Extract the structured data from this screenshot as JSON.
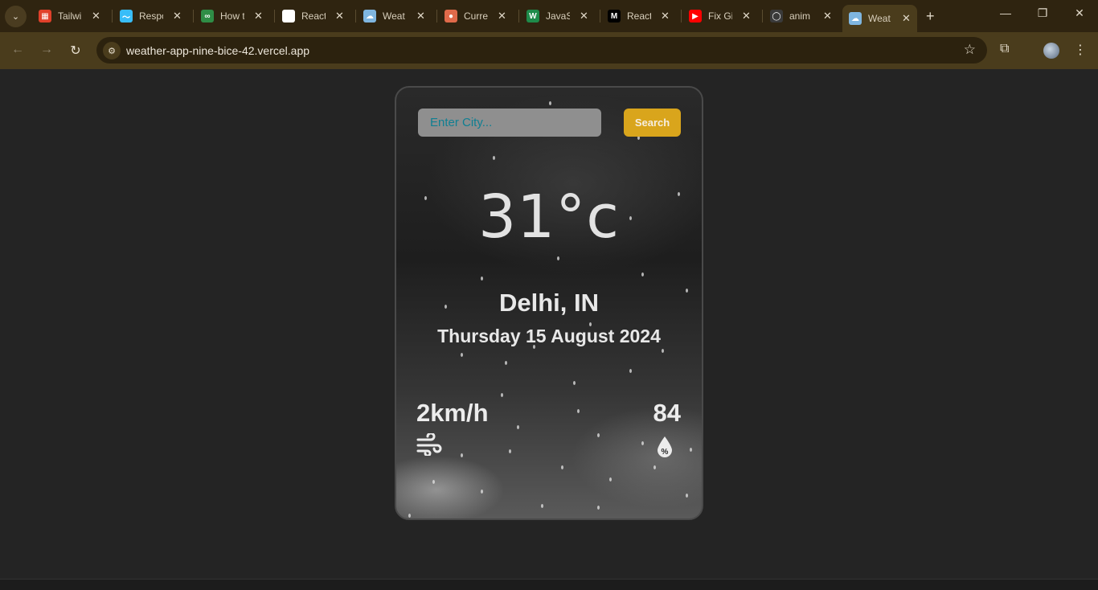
{
  "browser": {
    "tabs": [
      {
        "title": "Tailwi",
        "favicon_color": "#e0402a",
        "favicon_glyph": "▦"
      },
      {
        "title": "Respo",
        "favicon_color": "#38bdf8",
        "favicon_glyph": "〜"
      },
      {
        "title": "How t",
        "favicon_color": "#2f8d46",
        "favicon_glyph": "∞"
      },
      {
        "title": "React",
        "favicon_color": "#ffffff",
        "favicon_glyph": "◎"
      },
      {
        "title": "Weat",
        "favicon_color": "#7fb6e0",
        "favicon_glyph": "☁"
      },
      {
        "title": "Curre",
        "favicon_color": "#e06a4a",
        "favicon_glyph": "●"
      },
      {
        "title": "JavaS",
        "favicon_color": "#1e8a4a",
        "favicon_glyph": "W"
      },
      {
        "title": "React",
        "favicon_color": "#000000",
        "favicon_glyph": "M"
      },
      {
        "title": "Fix Gi",
        "favicon_color": "#ff0000",
        "favicon_glyph": "▶"
      },
      {
        "title": "anim",
        "favicon_color": "#3a3a3a",
        "favicon_glyph": "◯"
      }
    ],
    "active_tab": {
      "title": "Weat",
      "favicon_color": "#7fb6e0",
      "favicon_glyph": "☁"
    },
    "url": "weather-app-nine-bice-42.vercel.app"
  },
  "weather": {
    "search": {
      "placeholder": "Enter City...",
      "button_label": "Search"
    },
    "temperature": "31°c",
    "location": "Delhi, IN",
    "date": "Thursday 15 August 2024",
    "wind_speed": "2km/h",
    "humidity": "84"
  }
}
